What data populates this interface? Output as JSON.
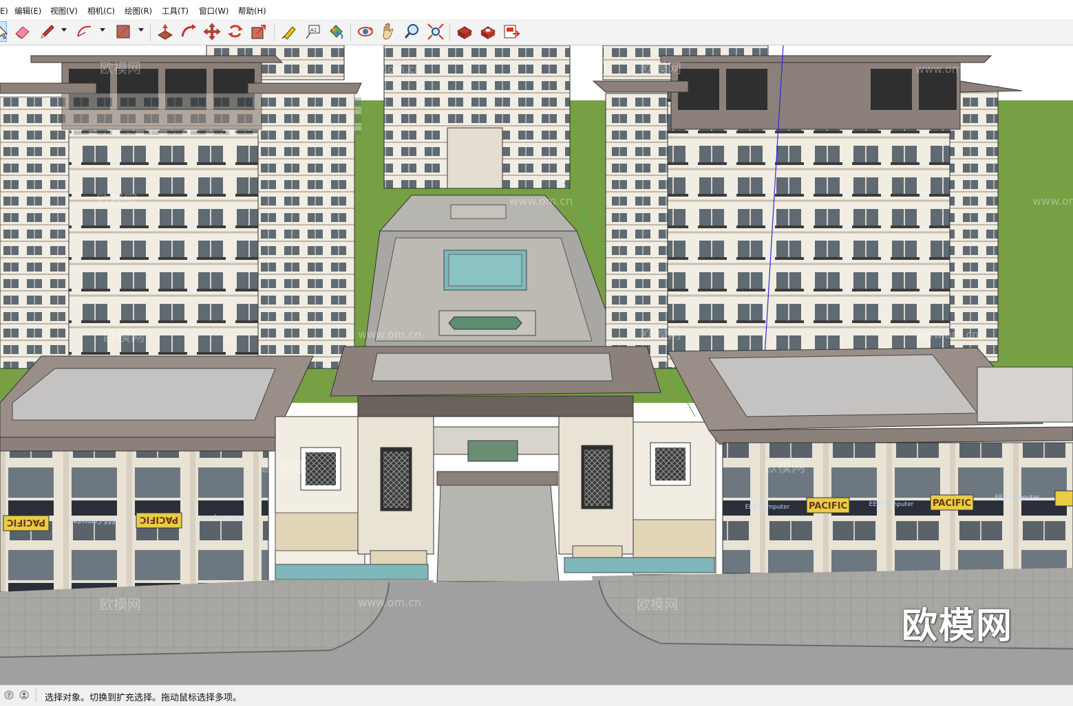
{
  "menubar": {
    "items": [
      {
        "id": "file",
        "label": "E)"
      },
      {
        "id": "edit",
        "label": "编辑(E)"
      },
      {
        "id": "view",
        "label": "视图(V)"
      },
      {
        "id": "camera",
        "label": "相机(C)"
      },
      {
        "id": "draw",
        "label": "绘图(R)"
      },
      {
        "id": "tools",
        "label": "工具(T)"
      },
      {
        "id": "window",
        "label": "窗口(W)"
      },
      {
        "id": "help",
        "label": "帮助(H)"
      }
    ]
  },
  "toolbar": {
    "tools": [
      {
        "icon": "select-arrow-icon",
        "selected": true
      },
      {
        "icon": "eraser-icon"
      },
      {
        "icon": "pencil-line-icon",
        "dropdown": true
      },
      {
        "icon": "arc-icon",
        "dropdown": true
      },
      {
        "icon": "rectangle-icon",
        "dropdown": true
      },
      {
        "icon": "push-pull-icon"
      },
      {
        "icon": "follow-me-icon"
      },
      {
        "icon": "move-icon"
      },
      {
        "icon": "rotate-icon"
      },
      {
        "icon": "scale-icon"
      },
      {
        "icon": "tape-measure-icon"
      },
      {
        "icon": "text-icon"
      },
      {
        "icon": "paint-bucket-icon"
      },
      {
        "icon": "orbit-icon"
      },
      {
        "icon": "pan-icon"
      },
      {
        "icon": "zoom-icon"
      },
      {
        "icon": "zoom-extents-icon"
      },
      {
        "icon": "3d-warehouse-icon"
      },
      {
        "icon": "extension-warehouse-icon"
      },
      {
        "icon": "layout-icon"
      }
    ]
  },
  "viewport": {
    "watermarks": [
      "欧模网",
      "www.om.cn"
    ],
    "sign_texts": [
      "PACIFIC",
      "EEE Computer"
    ],
    "brand_watermark": "欧模网"
  },
  "statusbar": {
    "text": "选择对象。切换到扩充选择。拖动鼠标选择多项。"
  },
  "colors": {
    "ground": "#76a043",
    "facade": "#f2ede2",
    "roof": "#8c807a",
    "water": "#7fb7ba",
    "road": "#a0a0a0",
    "glass": "#5f6a72"
  }
}
